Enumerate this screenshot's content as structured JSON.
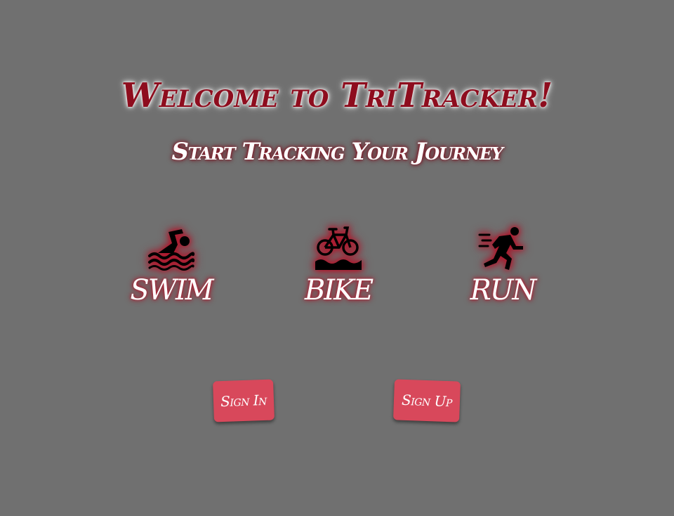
{
  "header": {
    "title": "Welcome to TriTracker!",
    "subtitle": "Start Tracking Your Journey"
  },
  "sports": [
    {
      "label": "SWIM",
      "icon": "swimmer-icon"
    },
    {
      "label": "BIKE",
      "icon": "bicycle-icon"
    },
    {
      "label": "RUN",
      "icon": "runner-icon"
    }
  ],
  "actions": {
    "sign_in_label": "Sign In",
    "sign_up_label": "Sign Up"
  },
  "colors": {
    "background": "#707070",
    "title": "#8e0d1e",
    "glow": "#c0142c",
    "button": "#d8485b",
    "icon": "#000000"
  }
}
